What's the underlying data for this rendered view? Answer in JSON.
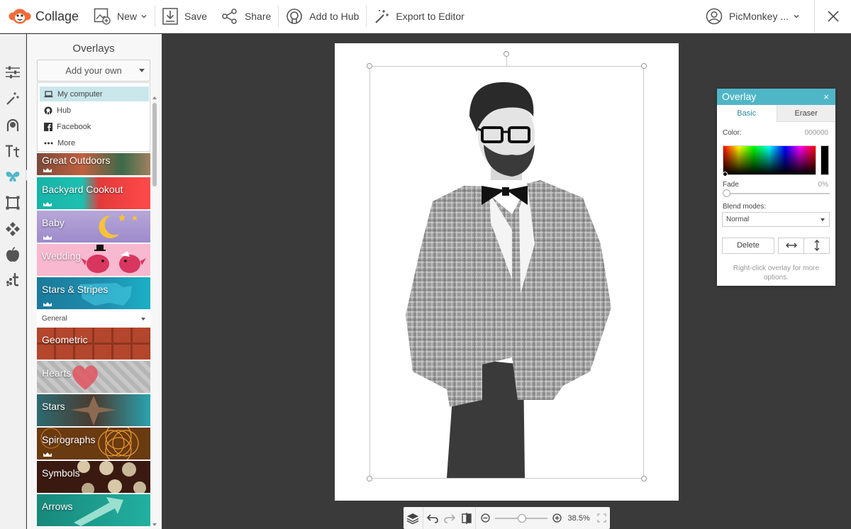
{
  "app": {
    "title": "Collage"
  },
  "toolbar": {
    "new_label": "New",
    "save_label": "Save",
    "share_label": "Share",
    "hub_label": "Add to Hub",
    "export_label": "Export to Editor",
    "account_label": "PicMonkey ..."
  },
  "panel": {
    "title": "Overlays",
    "add_own_label": "Add your own",
    "menu": [
      {
        "label": "My computer",
        "icon": "laptop-icon"
      },
      {
        "label": "Hub",
        "icon": "hub-icon"
      },
      {
        "label": "Facebook",
        "icon": "facebook-icon"
      },
      {
        "label": "More",
        "icon": "more-icon"
      }
    ],
    "themed": [
      {
        "label": "Great Outdoors"
      },
      {
        "label": "Backyard Cookout"
      },
      {
        "label": "Baby"
      },
      {
        "label": "Wedding"
      },
      {
        "label": "Stars & Stripes"
      }
    ],
    "section_label": "General",
    "general": [
      {
        "label": "Geometric"
      },
      {
        "label": "Hearts"
      },
      {
        "label": "Stars"
      },
      {
        "label": "Spirographs"
      },
      {
        "label": "Symbols"
      },
      {
        "label": "Arrows"
      }
    ]
  },
  "dialog": {
    "title": "Overlay",
    "close": "×",
    "tab_basic": "Basic",
    "tab_eraser": "Eraser",
    "color_label": "Color:",
    "color_value": "000000",
    "fade_label": "Fade",
    "fade_value": "0%",
    "blend_label": "Blend modes:",
    "blend_value": "Normal",
    "delete_label": "Delete",
    "hint": "Right-click overlay for more options."
  },
  "bottom": {
    "zoom": "38.5%"
  },
  "colors": {
    "accent": "#4fb6c7",
    "brand": "#f26b3a"
  }
}
